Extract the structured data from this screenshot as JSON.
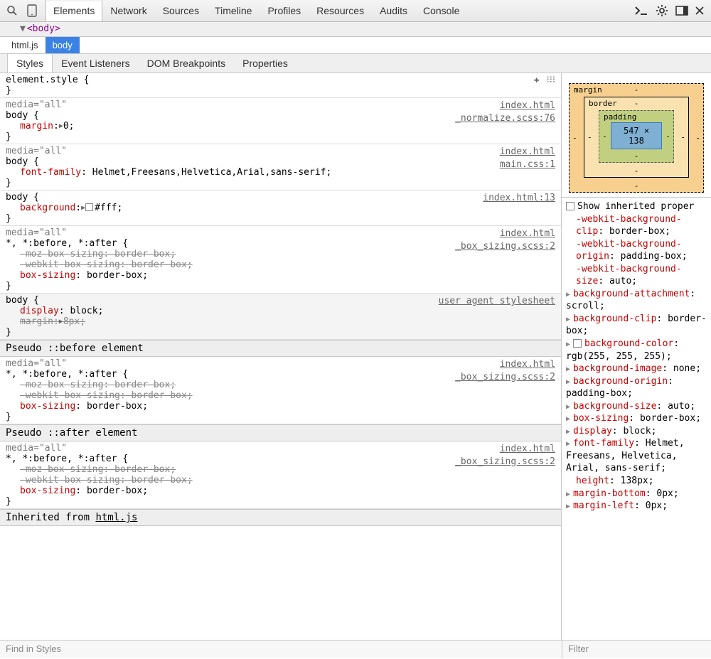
{
  "toolbar": {
    "tabs": [
      "Elements",
      "Network",
      "Sources",
      "Timeline",
      "Profiles",
      "Resources",
      "Audits",
      "Console"
    ],
    "active_tab": 0
  },
  "dom_strip": {
    "node": "<body>"
  },
  "crumbs": {
    "items": [
      "html.js",
      "body"
    ],
    "active": 1
  },
  "subtabs": {
    "items": [
      "Styles",
      "Event Listeners",
      "DOM Breakpoints",
      "Properties"
    ],
    "active": 0
  },
  "rules": {
    "element_style": {
      "selector": "element.style {",
      "close": "}"
    },
    "r1": {
      "media": "media=\"all\"",
      "selector": "body {",
      "prop": "margin",
      "tri": "▶",
      "val": "0",
      "close": "}",
      "link1": "index.html",
      "link2": "_normalize.scss:76"
    },
    "r2": {
      "media": "media=\"all\"",
      "selector": "body {",
      "prop": "font-family",
      "val": "Helmet,Freesans,Helvetica,Arial,sans-serif",
      "close": "}",
      "link1": "index.html",
      "link2": "main.css:1"
    },
    "r3": {
      "selector": "body {",
      "prop": "background",
      "tri": "▶",
      "val": "#fff",
      "close": "}",
      "link1": "index.html:13"
    },
    "r4": {
      "media": "media=\"all\"",
      "selector": "*, *:before, *:after {",
      "p1": "-moz-box-sizing",
      "v1": "border-box",
      "p2": "-webkit-box-sizing",
      "v2": "border-box",
      "p3": "box-sizing",
      "v3": "border-box",
      "close": "}",
      "link1": "index.html",
      "link2": "_box_sizing.scss:2"
    },
    "ua": {
      "selector": "body {",
      "p1": "display",
      "v1": "block",
      "p2": "margin",
      "tri": "▶",
      "v2": "8px",
      "close": "}",
      "link": "user agent stylesheet"
    },
    "pseudo_before": "Pseudo ::before element",
    "pseudo_after": "Pseudo ::after element",
    "inherited": {
      "label": "Inherited from ",
      "target": "html.js"
    }
  },
  "box_model": {
    "labels": {
      "margin": "margin",
      "border": "border",
      "padding": "padding"
    },
    "dash": "-",
    "content": "547 × 138"
  },
  "computed": {
    "show_inherited": "Show inherited proper",
    "items": [
      {
        "p": "-webkit-background-clip",
        "v": "border-box",
        "tri": false,
        "indent": true
      },
      {
        "p": "-webkit-background-origin",
        "v": "padding-box",
        "tri": false,
        "indent": true
      },
      {
        "p": "-webkit-background-size",
        "v": "auto",
        "tri": false,
        "indent": true
      },
      {
        "p": "background-attachment",
        "v": "scroll",
        "tri": true
      },
      {
        "p": "background-clip",
        "v": "border-box",
        "tri": true
      },
      {
        "p": "background-color",
        "v": "rgb(255, 255, 255)",
        "tri": true,
        "swatch": true
      },
      {
        "p": "background-image",
        "v": "none",
        "tri": true
      },
      {
        "p": "background-origin",
        "v": "padding-box",
        "tri": true
      },
      {
        "p": "background-size",
        "v": "auto",
        "tri": true
      },
      {
        "p": "box-sizing",
        "v": "border-box",
        "tri": true
      },
      {
        "p": "display",
        "v": "block",
        "tri": true
      },
      {
        "p": "font-family",
        "v": "Helmet, Freesans, Helvetica, Arial, sans-serif",
        "tri": true
      },
      {
        "p": "height",
        "v": "138px",
        "tri": false,
        "indent": true
      },
      {
        "p": "margin-bottom",
        "v": "0px",
        "tri": true
      },
      {
        "p": "margin-left",
        "v": "0px",
        "tri": true
      }
    ]
  },
  "footer": {
    "find": "Find in Styles",
    "filter": "Filter"
  }
}
